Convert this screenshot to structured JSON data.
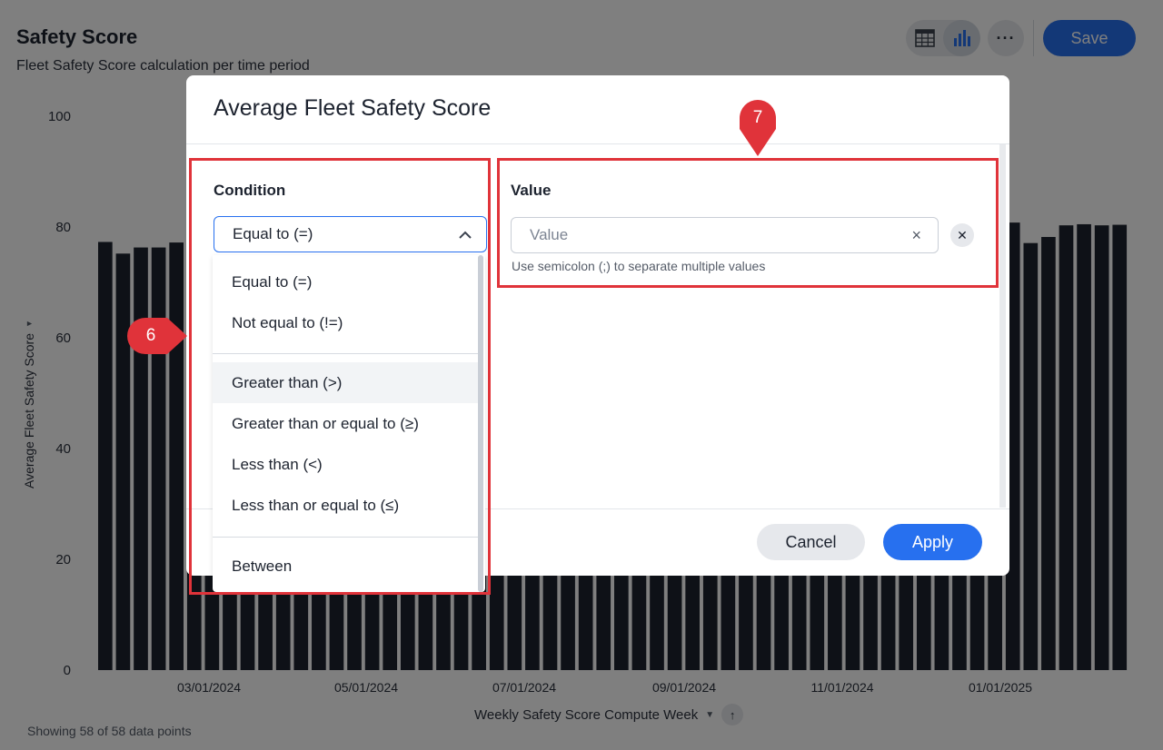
{
  "header": {
    "title": "Safety Score",
    "subtitle": "Fleet Safety Score calculation per time period",
    "save_label": "Save",
    "more_label": "···"
  },
  "chart": {
    "footer": "Showing 58 of 58 data points"
  },
  "chart_data": {
    "type": "bar",
    "xlabel": "Weekly Safety Score Compute Week",
    "ylabel": "Average Fleet Safety Score",
    "ylim": [
      0,
      100
    ],
    "yticks": [
      0,
      20,
      40,
      60,
      80,
      100
    ],
    "x_tick_labels": [
      "03/01/2024",
      "05/01/2024",
      "07/01/2024",
      "09/01/2024",
      "11/01/2024",
      "01/01/2025"
    ],
    "bar_color": "#1d232f",
    "values": [
      77.3,
      75.2,
      76.3,
      76.3,
      77.2,
      77.0,
      77.1,
      76.9,
      77.0,
      77.2,
      77.3,
      77.4,
      77.1,
      77.3,
      77.5,
      77.6,
      77.4,
      77.8,
      78.0,
      77.9,
      78.1,
      78.2,
      78.4,
      78.3,
      78.6,
      78.8,
      78.7,
      79.0,
      79.2,
      79.1,
      79.3,
      79.5,
      79.4,
      79.6,
      79.8,
      79.7,
      79.9,
      80.0,
      80.2,
      80.1,
      80.3,
      80.4,
      80.5,
      80.3,
      80.6,
      80.8,
      80.7,
      80.9,
      81.0,
      81.2,
      81.5,
      80.8,
      77.1,
      78.2,
      80.3,
      80.5,
      80.3,
      80.4
    ]
  },
  "modal": {
    "title": "Average Fleet Safety Score",
    "condition_label": "Condition",
    "condition_selected": "Equal to (=)",
    "value_label": "Value",
    "value_placeholder": "Value",
    "value_hint": "Use semicolon (;) to separate multiple values",
    "cancel_label": "Cancel",
    "apply_label": "Apply",
    "options": [
      "Equal to (=)",
      "Not equal to (!=)",
      "Greater than (>)",
      "Greater than or equal to (≥)",
      "Less than (<)",
      "Less than or equal to (≤)",
      "Between"
    ],
    "hovered_option": "Greater than (>)"
  },
  "callouts": {
    "marker_6": "6",
    "marker_7": "7",
    "color": "#e0333a"
  },
  "colors": {
    "accent": "#2770ef",
    "text": "#1d232f"
  }
}
